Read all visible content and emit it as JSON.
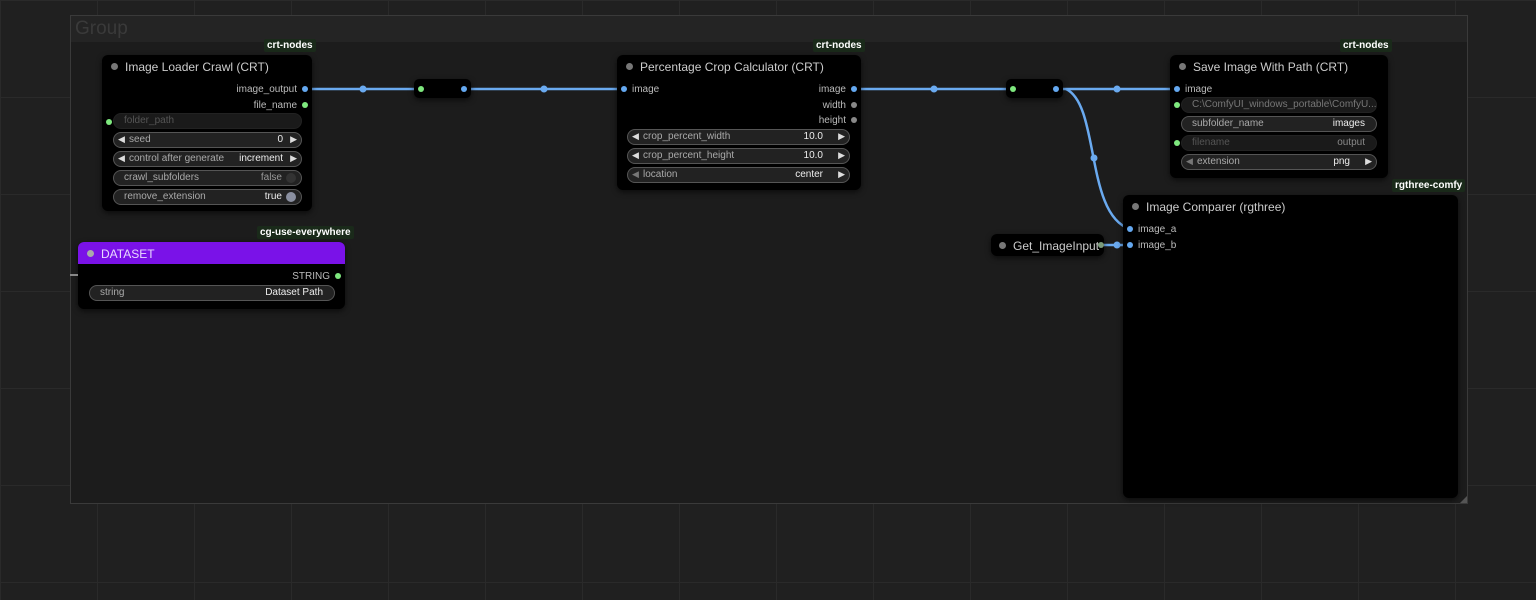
{
  "colors": {
    "link_image": "#6aaaf0",
    "port_green": "#7ee87e",
    "port_gray": "#888888",
    "port_blue": "#64a8f0",
    "dataset_header": "#7a12e8"
  },
  "group": {
    "title": "Group"
  },
  "image_loader": {
    "badge": "crt-nodes",
    "title": "Image Loader Crawl (CRT)",
    "outputs": [
      "image_output",
      "file_name"
    ],
    "widgets": {
      "folder_path": "folder_path",
      "seed_label": "seed",
      "seed_value": "0",
      "control_label": "control after generate",
      "control_value": "increment",
      "crawl_label": "crawl_subfolders",
      "crawl_value": "false",
      "remove_label": "remove_extension",
      "remove_value": "true"
    }
  },
  "dataset": {
    "badge": "cg-use-everywhere",
    "title": "DATASET",
    "output": "STRING",
    "widget_label": "string",
    "widget_value": "Dataset Path"
  },
  "crop_calc": {
    "badge": "crt-nodes",
    "title": "Percentage Crop Calculator (CRT)",
    "input": "image",
    "outputs": [
      "image",
      "width",
      "height"
    ],
    "widgets": {
      "width_label": "crop_percent_width",
      "width_value": "10.0",
      "height_label": "crop_percent_height",
      "height_value": "10.0",
      "location_label": "location",
      "location_value": "center"
    }
  },
  "save_image": {
    "badge": "crt-nodes",
    "title": "Save Image With Path (CRT)",
    "input": "image",
    "path_value": "C:\\ComfyUI_windows_portable\\ComfyU...",
    "subfolder_label": "subfolder_name",
    "subfolder_value": "images",
    "filename_label": "filename",
    "filename_value": "output",
    "extension_label": "extension",
    "extension_value": "png"
  },
  "comparer": {
    "badge": "rgthree-comfy",
    "title": "Image Comparer (rgthree)",
    "inputs": [
      "image_a",
      "image_b"
    ]
  },
  "get_node": {
    "title": "Get_ImageInput"
  }
}
